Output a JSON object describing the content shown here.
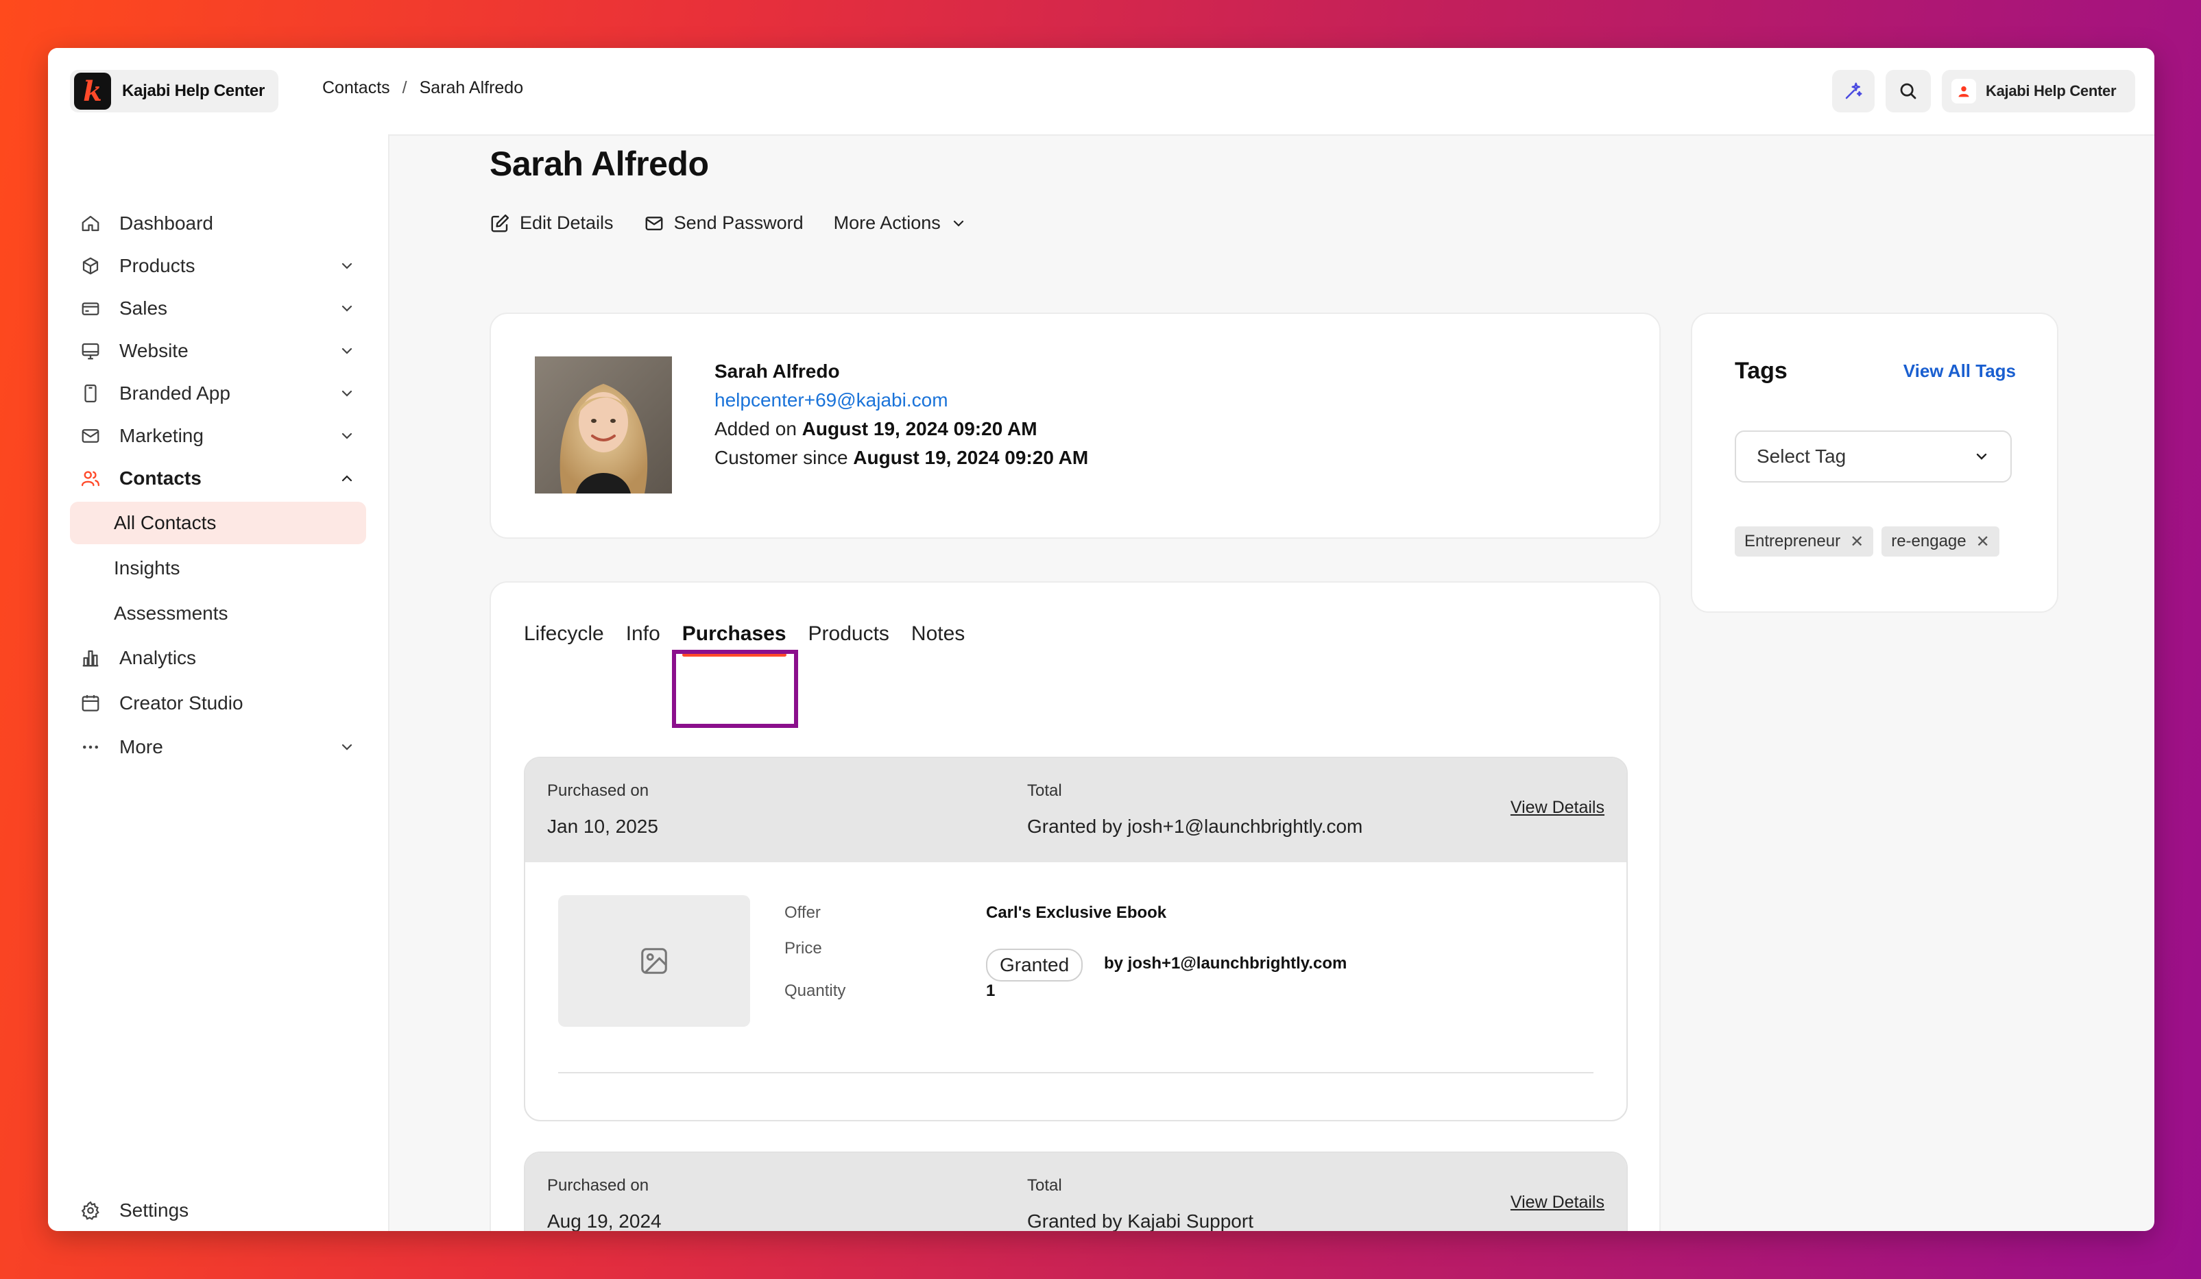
{
  "app": {
    "brand_name": "Kajabi Help Center",
    "brand_logo_letter": "k",
    "user_label": "Kajabi Help Center"
  },
  "breadcrumb": {
    "items": [
      "Contacts",
      "Sarah Alfredo"
    ],
    "separator": "/"
  },
  "sidebar": {
    "items": [
      {
        "label": "Dashboard",
        "icon": "home-icon",
        "expandable": false
      },
      {
        "label": "Products",
        "icon": "box-icon",
        "expandable": true
      },
      {
        "label": "Sales",
        "icon": "credit-card-icon",
        "expandable": true
      },
      {
        "label": "Website",
        "icon": "monitor-icon",
        "expandable": true
      },
      {
        "label": "Branded App",
        "icon": "phone-icon",
        "expandable": true
      },
      {
        "label": "Marketing",
        "icon": "mail-icon",
        "expandable": true
      },
      {
        "label": "Contacts",
        "icon": "users-icon",
        "expandable": true,
        "expanded": true
      },
      {
        "label": "Analytics",
        "icon": "bar-chart-icon",
        "expandable": false
      },
      {
        "label": "Creator Studio",
        "icon": "calendar-icon",
        "expandable": false
      },
      {
        "label": "More",
        "icon": "ellipsis-icon",
        "expandable": true
      }
    ],
    "contacts_sub": [
      "All Contacts",
      "Insights",
      "Assessments"
    ],
    "selected_sub": "All Contacts",
    "settings_label": "Settings"
  },
  "page": {
    "title": "Sarah Alfredo",
    "actions": {
      "edit": "Edit Details",
      "send_password": "Send Password",
      "more": "More Actions"
    }
  },
  "profile": {
    "name": "Sarah Alfredo",
    "email": "helpcenter+69@kajabi.com",
    "added_prefix": "Added on",
    "added_date": "August 19, 2024 09:20 AM",
    "customer_prefix": "Customer since",
    "customer_date": "August 19, 2024 09:20 AM"
  },
  "tags": {
    "title": "Tags",
    "view_all": "View All Tags",
    "select_placeholder": "Select Tag",
    "chips": [
      "Entrepreneur",
      "re-engage"
    ]
  },
  "tabs": {
    "items": [
      "Lifecycle",
      "Info",
      "Purchases",
      "Products",
      "Notes"
    ],
    "active": "Purchases"
  },
  "purchases": [
    {
      "purchased_label": "Purchased on",
      "purchased_date": "Jan 10, 2025",
      "total_label": "Total",
      "total_value": "Granted by josh+1@launchbrightly.com",
      "view_details": "View Details",
      "offer_label": "Offer",
      "offer_value": "Carl's Exclusive Ebook",
      "price_label": "Price",
      "price_badge": "Granted",
      "price_by": "by josh+1@launchbrightly.com",
      "quantity_label": "Quantity",
      "quantity_value": "1"
    },
    {
      "purchased_label": "Purchased on",
      "purchased_date": "Aug 19, 2024",
      "total_label": "Total",
      "total_value": "Granted by Kajabi Support",
      "view_details": "View Details"
    }
  ],
  "colors": {
    "accent": "#ff4a2a",
    "link": "#1a73d9",
    "highlight_box": "#8b0f8c",
    "selected_bg": "#fde8e4"
  }
}
